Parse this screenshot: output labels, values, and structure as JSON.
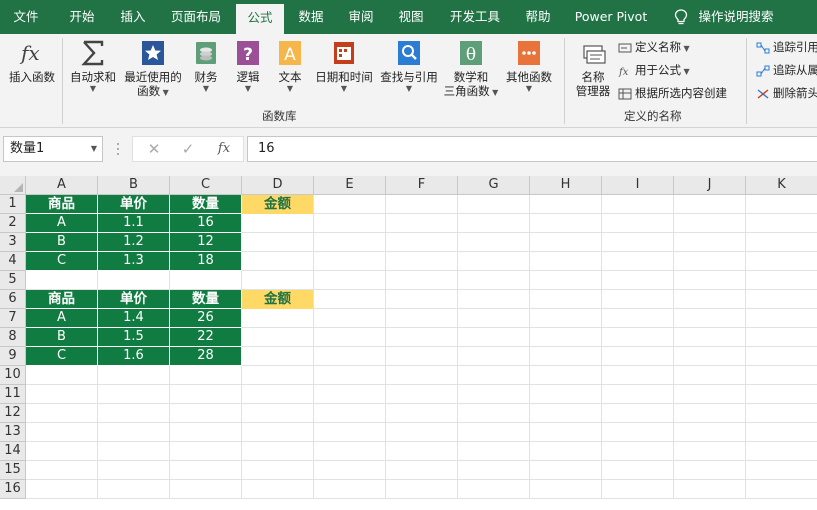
{
  "ribbon_tabs": [
    {
      "label": "文件",
      "active": false
    },
    {
      "label": "开始",
      "active": false
    },
    {
      "label": "插入",
      "active": false
    },
    {
      "label": "页面布局",
      "active": false
    },
    {
      "label": "公式",
      "active": true
    },
    {
      "label": "数据",
      "active": false
    },
    {
      "label": "审阅",
      "active": false
    },
    {
      "label": "视图",
      "active": false
    },
    {
      "label": "开发工具",
      "active": false
    },
    {
      "label": "帮助",
      "active": false
    },
    {
      "label": "Power Pivot",
      "active": false
    }
  ],
  "tell_me": "操作说明搜索",
  "ribbon": {
    "insert_function": "插入函数",
    "autosum": "自动求和",
    "recent_1": "最近使用的",
    "recent_2": "函数",
    "financial": "财务",
    "logical": "逻辑",
    "text": "文本",
    "datetime": "日期和时间",
    "lookup": "查找与引用",
    "math_1": "数学和",
    "math_2": "三角函数",
    "more": "其他函数",
    "group_library": "函数库",
    "name_mgr_1": "名称",
    "name_mgr_2": "管理器",
    "define_name": "定义名称",
    "use_in_formula": "用于公式",
    "create_from_sel": "根据所选内容创建",
    "group_defined": "定义的名称",
    "trace_precedents": "追踪引用",
    "trace_dependents": "追踪从属",
    "remove_arrows": "删除箭头"
  },
  "formula_bar": {
    "name_box": "数量1",
    "fx_label": "fx",
    "value": "16"
  },
  "grid": {
    "columns": [
      "A",
      "B",
      "C",
      "D",
      "E",
      "F",
      "G",
      "H",
      "I",
      "J",
      "K"
    ],
    "rows": [
      "1",
      "2",
      "3",
      "4",
      "5",
      "6",
      "7",
      "8",
      "9",
      "10",
      "11",
      "12",
      "13",
      "14",
      "15",
      "16"
    ],
    "table1": {
      "headers": [
        "商品",
        "单价",
        "数量"
      ],
      "rows": [
        [
          "A",
          "1.1",
          "16"
        ],
        [
          "B",
          "1.2",
          "12"
        ],
        [
          "C",
          "1.3",
          "18"
        ]
      ],
      "amount_label": "金额"
    },
    "table2": {
      "headers": [
        "商品",
        "单价",
        "数量"
      ],
      "rows": [
        [
          "A",
          "1.4",
          "26"
        ],
        [
          "B",
          "1.5",
          "22"
        ],
        [
          "C",
          "1.6",
          "28"
        ]
      ],
      "amount_label": "金额"
    }
  },
  "colors": {
    "ribbon_green": "#217346",
    "table_green": "#107c41",
    "amount_gold": "#ffd966"
  }
}
